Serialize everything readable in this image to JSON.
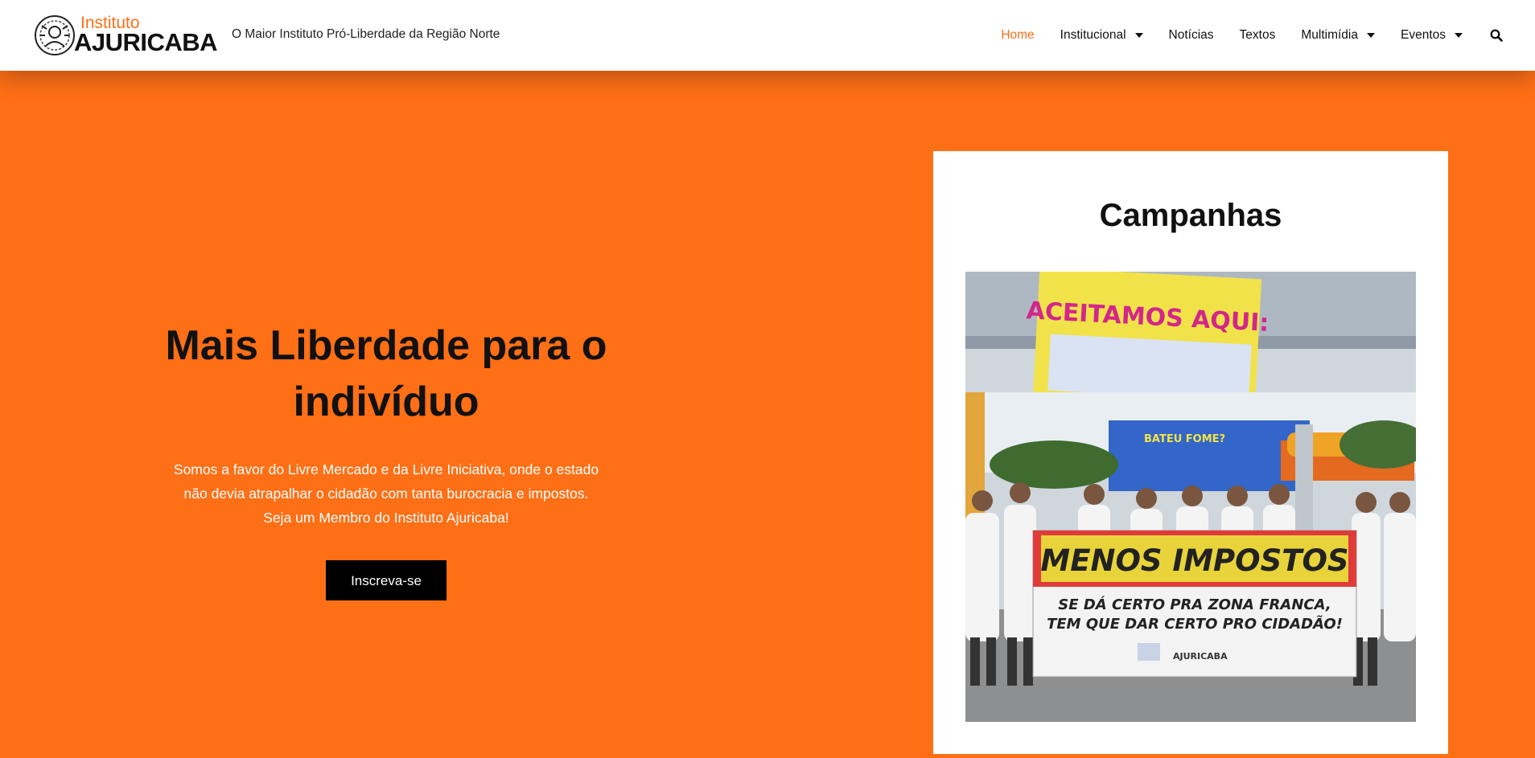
{
  "header": {
    "logo_small": "Instituto",
    "logo_big": "AJURICABA",
    "tagline": "O Maior Instituto Pró-Liberdade da Região Norte",
    "nav": [
      {
        "label": "Home",
        "active": true,
        "dropdown": false
      },
      {
        "label": "Institucional",
        "active": false,
        "dropdown": true
      },
      {
        "label": "Notícias",
        "active": false,
        "dropdown": false
      },
      {
        "label": "Textos",
        "active": false,
        "dropdown": false
      },
      {
        "label": "Multimídia",
        "active": false,
        "dropdown": true
      },
      {
        "label": "Eventos",
        "active": false,
        "dropdown": true
      }
    ],
    "search_icon": "search-icon"
  },
  "hero": {
    "title_line1": "Mais Liberdade para o",
    "title_line2": "indivíduo",
    "text_line1": "Somos a favor do Livre Mercado e da Livre Iniciativa, onde o estado",
    "text_line2": "não devia atrapalhar o cidadão com tanta burocracia e impostos.",
    "text_line3": "Seja um Membro do Instituto Ajuricaba!",
    "cta_label": "Inscreva-se"
  },
  "campaign": {
    "title": "Campanhas",
    "photo": {
      "banner_top": "ACEITAMOS AQUI:",
      "sign_text": "BATEU FOME?",
      "banner_main": "MENOS IMPOSTOS",
      "banner_sub1": "SE DÁ CERTO PRA ZONA FRANCA,",
      "banner_sub2": "TEM QUE DAR CERTO PRO CIDADÃO!",
      "banner_logo": "AJURICABA"
    }
  },
  "colors": {
    "brand_orange": "#ff6f16",
    "text_dark": "#111111",
    "white": "#ffffff"
  }
}
